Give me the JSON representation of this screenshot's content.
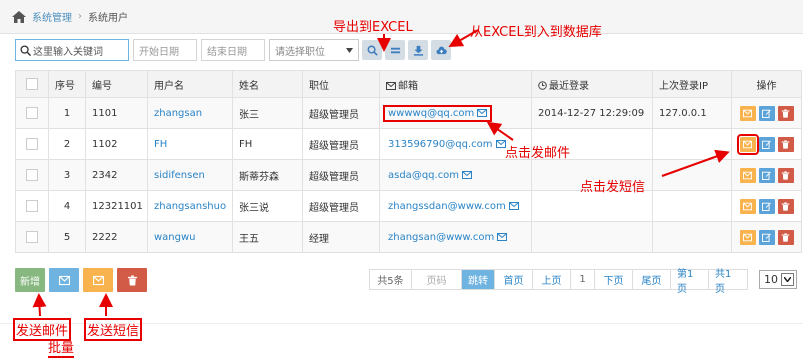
{
  "breadcrumb": {
    "parent": "系统管理",
    "current": "系统用户"
  },
  "toolbar": {
    "search_placeholder": "这里输入关键词",
    "start_date": "开始日期",
    "end_date": "结束日期",
    "role_select": "请选择职位"
  },
  "annotations": {
    "export": "导出到EXCEL",
    "import": "从EXCEL到入到数据库",
    "send_mail": "点击发邮件",
    "send_sms": "点击发短信",
    "batch_mail": "发送邮件",
    "batch_label": "批量",
    "batch_sms": "发送短信"
  },
  "table": {
    "headers": [
      "序号",
      "编号",
      "用户名",
      "姓名",
      "职位",
      "邮箱",
      "最近登录",
      "上次登录IP",
      "操作"
    ],
    "rows": [
      {
        "seq": "1",
        "no": "1101",
        "user": "zhangsan",
        "name": "张三",
        "role": "超级管理员",
        "email": "wwwwq@qq.com",
        "last": "2014-12-27 12:29:09",
        "ip": "127.0.0.1"
      },
      {
        "seq": "2",
        "no": "1102",
        "user": "FH",
        "name": "FH",
        "role": "超级管理员",
        "email": "313596790@qq.com",
        "last": "",
        "ip": ""
      },
      {
        "seq": "3",
        "no": "2342",
        "user": "sidifensen",
        "name": "斯蒂芬森",
        "role": "超级管理员",
        "email": "asda@qq.com",
        "last": "",
        "ip": ""
      },
      {
        "seq": "4",
        "no": "12321101",
        "user": "zhangsanshuo",
        "name": "张三说",
        "role": "超级管理员",
        "email": "zhangssdan@www.com",
        "last": "",
        "ip": ""
      },
      {
        "seq": "5",
        "no": "2222",
        "user": "wangwu",
        "name": "王五",
        "role": "经理",
        "email": "zhangsan@www.com",
        "last": "",
        "ip": ""
      }
    ]
  },
  "bottom": {
    "add_label": "新增"
  },
  "pager": {
    "total": "共5条",
    "page_input": "页码",
    "go": "跳转",
    "first": "首页",
    "prev": "上页",
    "current": "1",
    "next": "下页",
    "last": "尾页",
    "page_of": "第1页",
    "total_pages": "共1页",
    "page_size": "10"
  },
  "colors": {
    "accent": "#6fb3e0",
    "link": "#2a84c7",
    "annotation": "#e60000"
  }
}
